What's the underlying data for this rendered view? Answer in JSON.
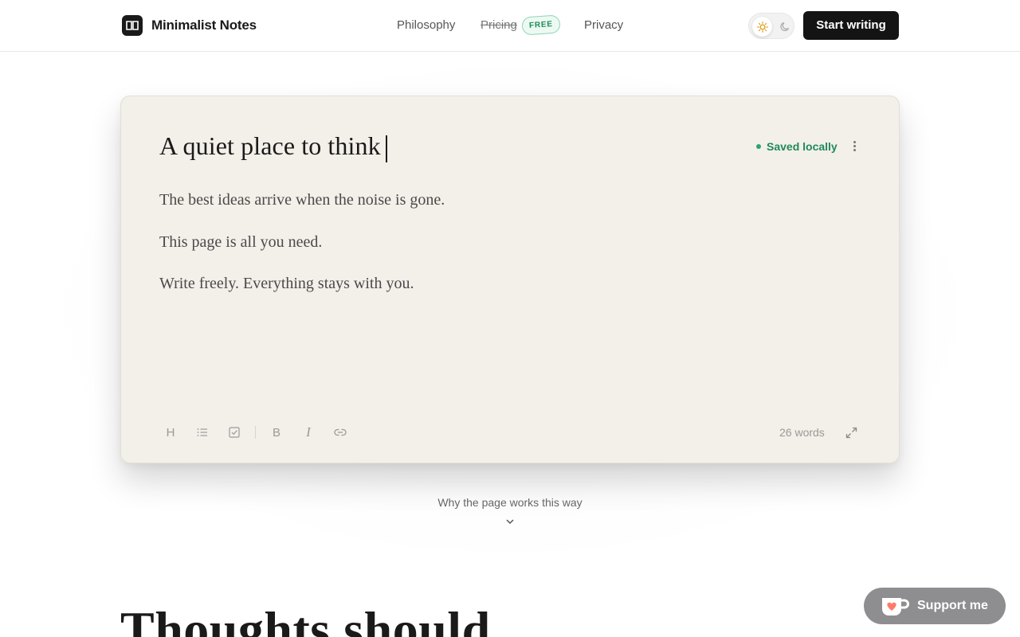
{
  "header": {
    "brand_name": "Minimalist Notes",
    "nav": {
      "philosophy": "Philosophy",
      "pricing": "Pricing",
      "pricing_badge": "FREE",
      "privacy": "Privacy"
    },
    "theme_toggle": {
      "options": [
        "light",
        "dark"
      ],
      "selected": "light",
      "light_icon": "sun-icon",
      "dark_icon": "moon-icon"
    },
    "cta_label": "Start writing"
  },
  "editor": {
    "title": "A quiet place to think",
    "status": "Saved locally",
    "paragraphs": [
      "The best ideas arrive when the noise is gone.",
      "This page is all you need.",
      "Write freely. Everything stays with you."
    ],
    "toolbar": [
      "heading-icon",
      "bulleted-list-icon",
      "checkbox-icon",
      "bold-icon",
      "italic-icon",
      "link-icon"
    ],
    "toolbar_glyphs": {
      "heading": "H",
      "bold": "B",
      "italic": "I"
    },
    "word_count": "26 words"
  },
  "why_link": "Why the page works this way",
  "headline": "Thoughts should",
  "support_label": "Support me",
  "colors": {
    "accent_dark": "#141414",
    "saved_green": "#1f8a5a",
    "card_background": "#f3efe9",
    "support_gray": "#8e8e90"
  }
}
